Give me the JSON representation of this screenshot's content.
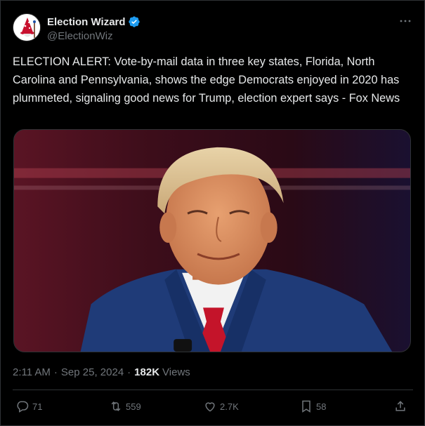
{
  "author": {
    "display_name": "Election Wizard",
    "handle": "@ElectionWiz",
    "verified": true,
    "avatar_icon": "wizard-avatar-icon"
  },
  "post": {
    "text": "ELECTION ALERT: Vote-by-mail data in three key states, Florida, North Carolina and Pennsylvania, shows the edge Democrats enjoyed in 2020 has plummeted, signaling good news for Trump, election expert says - Fox News",
    "time": "2:11 AM",
    "date": "Sep 25, 2024",
    "views_count": "182K",
    "views_label": "Views"
  },
  "actions": {
    "replies": "71",
    "reposts": "559",
    "likes": "2.7K",
    "bookmarks": "58"
  },
  "colors": {
    "background": "#000000",
    "text": "#e7e9ea",
    "secondary": "#71767b",
    "verified": "#1d9bf0"
  }
}
